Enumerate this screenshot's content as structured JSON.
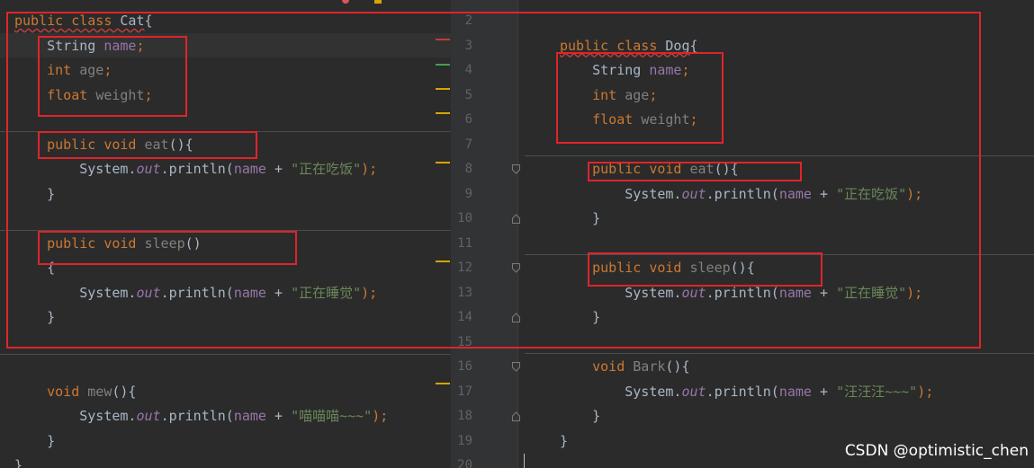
{
  "left": {
    "lines": [
      {
        "segs": [
          {
            "t": "public class ",
            "c": "kw squig"
          },
          {
            "t": "Cat",
            "c": "cls squig"
          },
          {
            "t": "{",
            "c": "cls"
          }
        ]
      },
      {
        "segs": [
          {
            "t": "    "
          },
          {
            "t": "String ",
            "c": "cls"
          },
          {
            "t": "name",
            "c": "fld"
          },
          {
            "t": ";",
            "c": "kw"
          }
        ]
      },
      {
        "segs": [
          {
            "t": "    "
          },
          {
            "t": "int ",
            "c": "kw"
          },
          {
            "t": "age",
            "c": "unused"
          },
          {
            "t": ";",
            "c": "kw"
          }
        ]
      },
      {
        "segs": [
          {
            "t": "    "
          },
          {
            "t": "float ",
            "c": "kw"
          },
          {
            "t": "weight",
            "c": "unused"
          },
          {
            "t": ";",
            "c": "kw"
          }
        ]
      },
      {
        "segs": []
      },
      {
        "segs": [
          {
            "t": "    "
          },
          {
            "t": "public void ",
            "c": "kw"
          },
          {
            "t": "eat",
            "c": "unused"
          },
          {
            "t": "(){",
            "c": "cls"
          }
        ]
      },
      {
        "segs": [
          {
            "t": "        System."
          },
          {
            "t": "out",
            "c": "stat"
          },
          {
            "t": ".println("
          },
          {
            "t": "name",
            "c": "fld"
          },
          {
            "t": " + "
          },
          {
            "t": "\"正在吃饭\"",
            "c": "str"
          },
          {
            "t": ");",
            "c": "kw"
          }
        ]
      },
      {
        "segs": [
          {
            "t": "    }"
          }
        ]
      },
      {
        "segs": []
      },
      {
        "segs": [
          {
            "t": "    "
          },
          {
            "t": "public void ",
            "c": "kw"
          },
          {
            "t": "sleep",
            "c": "unused"
          },
          {
            "t": "()",
            "c": "cls"
          }
        ]
      },
      {
        "segs": [
          {
            "t": "    {"
          }
        ]
      },
      {
        "segs": [
          {
            "t": "        System."
          },
          {
            "t": "out",
            "c": "stat"
          },
          {
            "t": ".println("
          },
          {
            "t": "name",
            "c": "fld"
          },
          {
            "t": " + "
          },
          {
            "t": "\"正在睡觉\"",
            "c": "str"
          },
          {
            "t": ");",
            "c": "kw"
          }
        ]
      },
      {
        "segs": [
          {
            "t": "    }"
          }
        ]
      },
      {
        "segs": []
      },
      {
        "segs": []
      },
      {
        "segs": [
          {
            "t": "    "
          },
          {
            "t": "void ",
            "c": "kw"
          },
          {
            "t": "mew",
            "c": "unused"
          },
          {
            "t": "(){",
            "c": "cls"
          }
        ]
      },
      {
        "segs": [
          {
            "t": "        System."
          },
          {
            "t": "out",
            "c": "stat"
          },
          {
            "t": ".println("
          },
          {
            "t": "name",
            "c": "fld"
          },
          {
            "t": " + "
          },
          {
            "t": "\"喵喵喵~~~\"",
            "c": "str"
          },
          {
            "t": ");",
            "c": "kw"
          }
        ]
      },
      {
        "segs": [
          {
            "t": "    }"
          }
        ]
      },
      {
        "segs": [
          {
            "t": "}"
          }
        ]
      }
    ]
  },
  "right": {
    "line_numbers": [
      "2",
      "3",
      "4",
      "5",
      "6",
      "7",
      "8",
      "9",
      "10",
      "11",
      "12",
      "13",
      "14",
      "15",
      "16",
      "17",
      "18",
      "19",
      "20"
    ],
    "lines": [
      {
        "segs": []
      },
      {
        "segs": [
          {
            "t": "public class ",
            "c": "kw squig"
          },
          {
            "t": "Dog",
            "c": "cls squig"
          },
          {
            "t": "{",
            "c": "cls"
          }
        ]
      },
      {
        "segs": [
          {
            "t": "    "
          },
          {
            "t": "String ",
            "c": "cls"
          },
          {
            "t": "name",
            "c": "fld"
          },
          {
            "t": ";",
            "c": "kw"
          }
        ]
      },
      {
        "segs": [
          {
            "t": "    "
          },
          {
            "t": "int ",
            "c": "kw"
          },
          {
            "t": "age",
            "c": "unused"
          },
          {
            "t": ";",
            "c": "kw"
          }
        ]
      },
      {
        "segs": [
          {
            "t": "    "
          },
          {
            "t": "float ",
            "c": "kw"
          },
          {
            "t": "weight",
            "c": "unused"
          },
          {
            "t": ";",
            "c": "kw"
          }
        ]
      },
      {
        "segs": []
      },
      {
        "segs": [
          {
            "t": "    "
          },
          {
            "t": "public void ",
            "c": "kw"
          },
          {
            "t": "eat",
            "c": "unused"
          },
          {
            "t": "(){",
            "c": "cls"
          }
        ]
      },
      {
        "segs": [
          {
            "t": "        System."
          },
          {
            "t": "out",
            "c": "stat"
          },
          {
            "t": ".println("
          },
          {
            "t": "name",
            "c": "fld"
          },
          {
            "t": " + "
          },
          {
            "t": "\"正在吃饭\"",
            "c": "str"
          },
          {
            "t": ");",
            "c": "kw"
          }
        ]
      },
      {
        "segs": [
          {
            "t": "    }"
          }
        ]
      },
      {
        "segs": []
      },
      {
        "segs": [
          {
            "t": "    "
          },
          {
            "t": "public void ",
            "c": "kw"
          },
          {
            "t": "sleep",
            "c": "unused"
          },
          {
            "t": "(){",
            "c": "cls"
          }
        ]
      },
      {
        "segs": [
          {
            "t": "        System."
          },
          {
            "t": "out",
            "c": "stat"
          },
          {
            "t": ".println("
          },
          {
            "t": "name",
            "c": "fld"
          },
          {
            "t": " + "
          },
          {
            "t": "\"正在睡觉\"",
            "c": "str"
          },
          {
            "t": ");",
            "c": "kw"
          }
        ]
      },
      {
        "segs": [
          {
            "t": "    }"
          }
        ]
      },
      {
        "segs": []
      },
      {
        "segs": [
          {
            "t": "    "
          },
          {
            "t": "void ",
            "c": "kw"
          },
          {
            "t": "Bark",
            "c": "unused"
          },
          {
            "t": "(){",
            "c": "cls"
          }
        ]
      },
      {
        "segs": [
          {
            "t": "        System."
          },
          {
            "t": "out",
            "c": "stat"
          },
          {
            "t": ".println("
          },
          {
            "t": "name",
            "c": "fld"
          },
          {
            "t": " + "
          },
          {
            "t": "\"汪汪汪~~~\"",
            "c": "str"
          },
          {
            "t": ");",
            "c": "kw"
          }
        ]
      },
      {
        "segs": [
          {
            "t": "    }"
          }
        ]
      },
      {
        "segs": [
          {
            "t": "}"
          }
        ]
      },
      {
        "segs": []
      }
    ]
  },
  "gutter_icons": [
    "fold-collapse-icon",
    "fold-expand-icon"
  ],
  "colors": {
    "keyword": "#cc7832",
    "field": "#9876aa",
    "string": "#6a8759",
    "text": "#a9b7c6",
    "unused": "#808080",
    "highlight_box": "#e0242a",
    "background": "#2b2b2b"
  },
  "watermark": "CSDN @optimistic_chen"
}
